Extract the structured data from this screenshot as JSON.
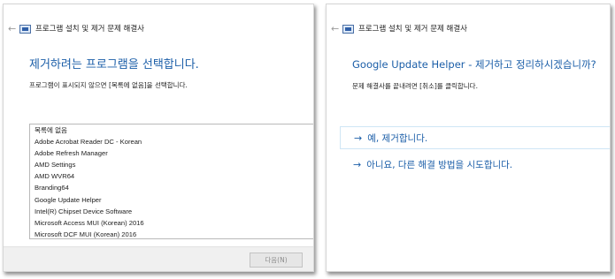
{
  "left_panel": {
    "back_icon": "back-arrow-icon",
    "app_icon": "troubleshooter-icon",
    "window_title": "프로그램 설치 및 제거 문제 해결사",
    "heading": "제거하려는 프로그램을 선택합니다.",
    "instruction": "프로그램이 표시되지 않으면 [목록에 없음]을 선택합니다.",
    "programs": [
      "목록에 없음",
      "Adobe Acrobat Reader DC - Korean",
      "Adobe Refresh Manager",
      "AMD Settings",
      "AMD WVR64",
      "Branding64",
      "Google Update Helper",
      "Intel(R) Chipset Device Software",
      "Microsoft Access MUI (Korean) 2016",
      "Microsoft DCF MUI (Korean) 2016"
    ],
    "next_button_label": "다음(N)"
  },
  "right_panel": {
    "back_icon": "back-arrow-icon",
    "app_icon": "troubleshooter-icon",
    "window_title": "프로그램 설치 및 제거 문제 해결사",
    "heading": "Google Update Helper - 제거하고 정리하시겠습니까?",
    "instruction": "문제 해결사를 끝내려면 [취소]를 클릭합니다.",
    "options": [
      {
        "arrow": "→",
        "label": "예, 제거합니다."
      },
      {
        "arrow": "→",
        "label": "아니요, 다른 해결 방법을 시도합니다."
      }
    ]
  },
  "colors": {
    "heading_blue": "#1b5ea8",
    "footer_gray": "#f0f0f0",
    "disabled_text": "#8d8d8d"
  }
}
